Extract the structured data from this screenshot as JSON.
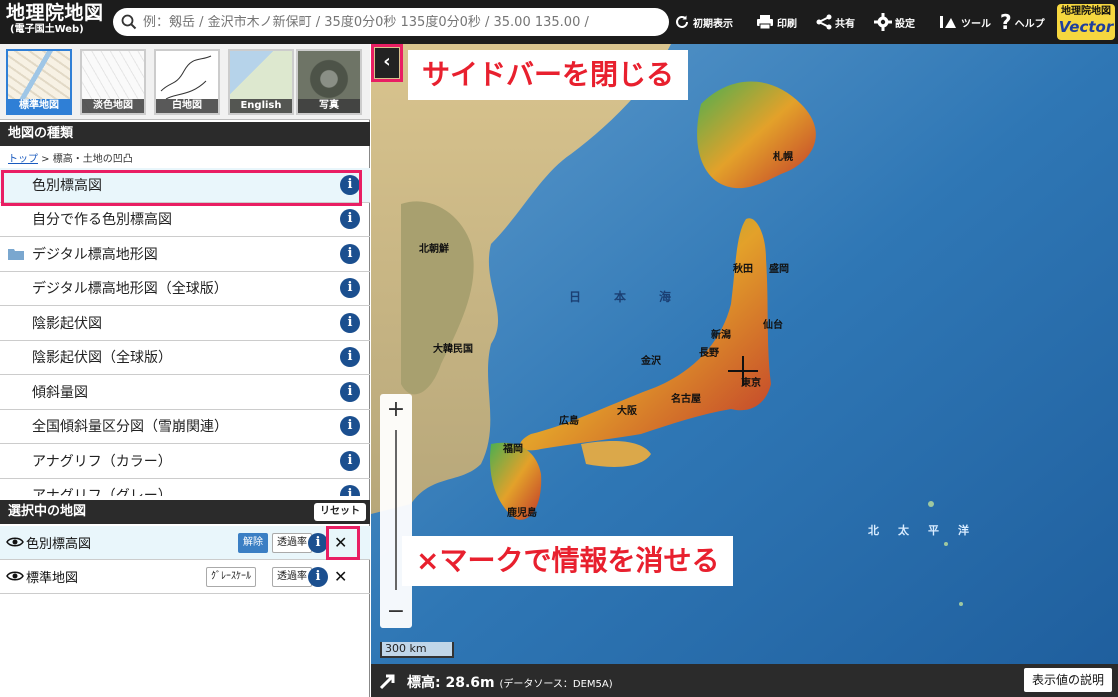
{
  "header": {
    "logo_main": "地理院地図",
    "logo_sub": "(電子国土Web)",
    "search_placeholder": "例：剱岳 / 金沢市木ノ新保町 / 35度0分0秒 135度0分0秒 / 35.00 135.00 /",
    "buttons": {
      "reset_view": "初期表示",
      "print": "印刷",
      "share": "共有",
      "settings": "設定",
      "tools": "ツール",
      "help": "ヘルプ"
    },
    "vector_badge": {
      "line1": "地理院地図",
      "line2": "Vector"
    }
  },
  "basemaps": [
    {
      "label": "標準地図",
      "selected": true
    },
    {
      "label": "淡色地図",
      "selected": false
    },
    {
      "label": "白地図",
      "selected": false
    },
    {
      "label": "English",
      "selected": false
    },
    {
      "label": "写真",
      "selected": false
    }
  ],
  "map_types": {
    "title": "地図の種類",
    "breadcrumb_link": "トップ",
    "breadcrumb_rest": " > 標高・土地の凹凸",
    "items": [
      {
        "label": "色別標高図",
        "selected": true,
        "folder": false
      },
      {
        "label": "自分で作る色別標高図",
        "folder": false
      },
      {
        "label": "デジタル標高地形図",
        "folder": true
      },
      {
        "label": "デジタル標高地形図（全球版）",
        "folder": false
      },
      {
        "label": "陰影起伏図",
        "folder": false
      },
      {
        "label": "陰影起伏図（全球版）",
        "folder": false
      },
      {
        "label": "傾斜量図",
        "folder": false
      },
      {
        "label": "全国傾斜量区分図（雪崩関連）",
        "folder": false
      },
      {
        "label": "アナグリフ（カラー）",
        "folder": false
      },
      {
        "label": "アナグリフ（グレー）",
        "folder": false
      }
    ],
    "info_glyph": "i"
  },
  "selected_maps": {
    "title": "選択中の地図",
    "reset_label": "リセット",
    "rows": [
      {
        "name": "色別標高図",
        "chip1": "解除",
        "chip2": "透過率",
        "close": "✕"
      },
      {
        "name": "標準地図",
        "chip1": "ｸﾞﾚｰｽｹｰﾙ",
        "chip2": "透過率",
        "close": "✕"
      }
    ]
  },
  "map": {
    "callout_sidebar": "サイドバーを閉じる",
    "callout_close": "×マークで情報を消せる",
    "toggle_glyph": "‹",
    "zoom_in": "+",
    "zoom_out": "−",
    "scale": "300 km",
    "labels": {
      "n_korea": "北朝鮮",
      "s_korea": "大韓民国",
      "sea_of_japan_1": "日",
      "sea_of_japan_2": "本",
      "sea_of_japan_3": "海",
      "pacific_1": "北",
      "pacific_2": "太",
      "pacific_3": "平",
      "pacific_4": "洋",
      "sapporo": "札幌",
      "akita": "秋田",
      "morioka": "盛岡",
      "sendai": "仙台",
      "niigata": "新潟",
      "kanazawa": "金沢",
      "nagano": "長野",
      "tokyo": "東京",
      "nagoya": "名古屋",
      "osaka": "大阪",
      "hiroshima": "広島",
      "fukuoka": "福岡",
      "kagoshima": "鹿児島"
    }
  },
  "status": {
    "elevation": "標高: 28.6m",
    "source": "(データソース：DEM5A)",
    "explain_button": "表示値の説明"
  },
  "colors": {
    "accent_pink": "#e91e63",
    "callout_red": "#e8202e",
    "info_blue": "#1b4f8f",
    "selected_bg": "#e9f6fb"
  }
}
